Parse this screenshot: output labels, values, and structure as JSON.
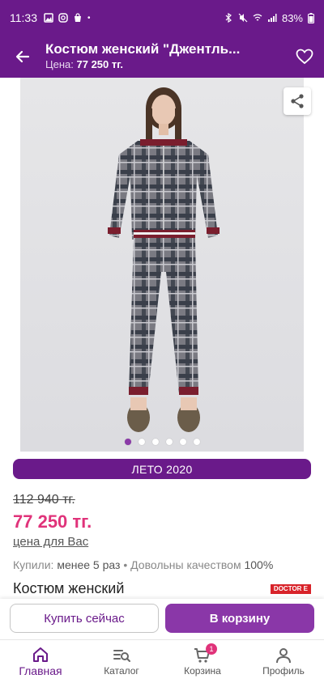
{
  "status_bar": {
    "time": "11:33",
    "battery": "83%"
  },
  "header": {
    "title": "Костюм женский \"Джентль...",
    "price_label": "Цена:",
    "price_value": "77 250 тг."
  },
  "gallery": {
    "dots_count": 6,
    "active_index": 0
  },
  "product": {
    "season_label": "ЛЕТО 2020",
    "old_price": "112 940 тг.",
    "new_price": "77 250 тг.",
    "your_price_link": "цена для Вас",
    "bought_label": "Купили:",
    "bought_value": "менее 5 раз",
    "separator": "•",
    "quality_label": "Довольны качеством",
    "quality_value": "100%",
    "name": "Костюм женский",
    "brand": "DOCTOR E"
  },
  "actions": {
    "buy_now": "Купить сейчас",
    "to_cart": "В корзину"
  },
  "bottom_nav": {
    "home": "Главная",
    "catalog": "Каталог",
    "cart": "Корзина",
    "cart_badge": "1",
    "profile": "Профиль"
  },
  "colors": {
    "brand_purple": "#6a1a8a",
    "price_pink": "#e0337a",
    "button_purple": "#8a37a8"
  }
}
